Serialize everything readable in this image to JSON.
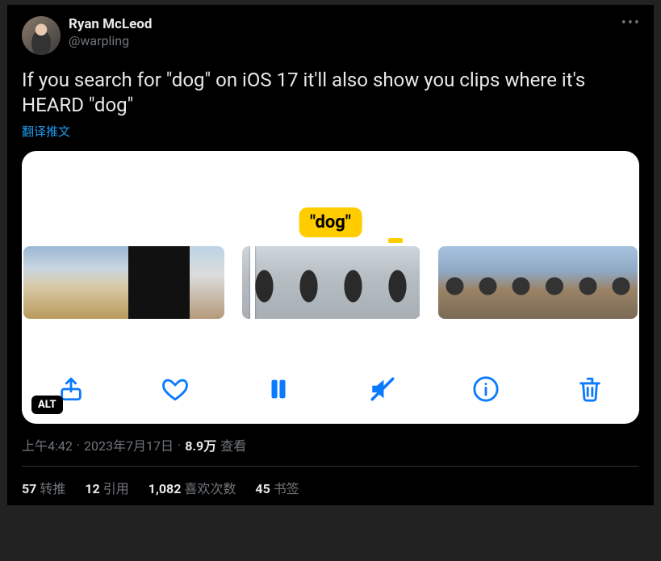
{
  "author": {
    "display_name": "Ryan McLeod",
    "handle": "@warpling"
  },
  "more_label": "•••",
  "body_text": "If you search for \"dog\" on iOS 17 it'll also show you clips where it's HEARD \"dog\"",
  "translate_label": "翻译推文",
  "media": {
    "caption_text": "\"dog\"",
    "alt_badge": "ALT"
  },
  "meta": {
    "time": "上午4:42",
    "dot1": "·",
    "date": "2023年7月17日",
    "dot2": "·",
    "views_count": "8.9万",
    "views_label": "查看"
  },
  "stats": {
    "retweets": {
      "n": "57",
      "label": "转推"
    },
    "quotes": {
      "n": "12",
      "label": "引用"
    },
    "likes": {
      "n": "1,082",
      "label": "喜欢次数"
    },
    "bookmarks": {
      "n": "45",
      "label": "书签"
    }
  }
}
